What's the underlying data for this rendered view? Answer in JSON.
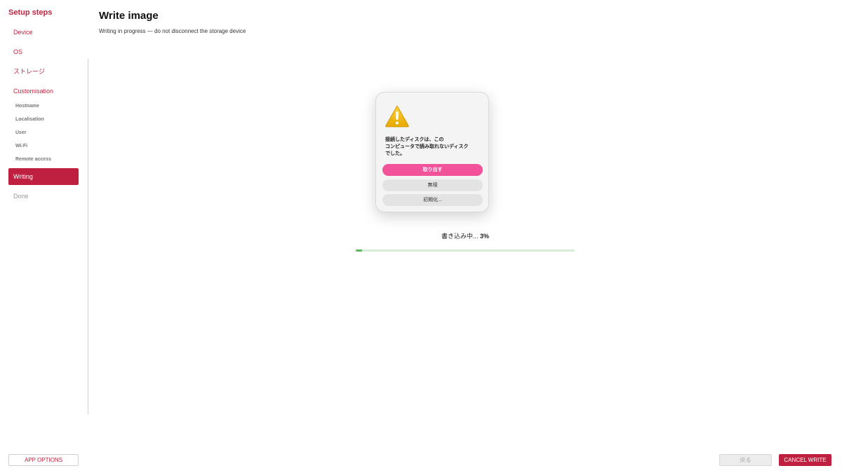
{
  "sidebar": {
    "title": "Setup steps",
    "items": [
      {
        "label": "Device"
      },
      {
        "label": "OS"
      },
      {
        "label": "ストレージ"
      },
      {
        "label": "Customisation"
      }
    ],
    "sub_items": [
      {
        "label": "Hostname"
      },
      {
        "label": "Localisation"
      },
      {
        "label": "User"
      },
      {
        "label": "Wi-Fi"
      },
      {
        "label": "Remote access"
      }
    ],
    "active": {
      "label": "Writing"
    },
    "done": {
      "label": "Done"
    }
  },
  "header": {
    "title": "Write image",
    "subtitle": "Writing in progress — do not disconnect the storage device"
  },
  "dialog": {
    "icon": "warning-icon",
    "message": "接続したディスクは、この\nコンピュータで読み取れないディスク\nでした。",
    "buttons": {
      "eject": "取り出す",
      "ignore": "無視",
      "initialize": "初期化..."
    }
  },
  "progress": {
    "label": "書き込み中...",
    "percent_text": "3%",
    "value": 3
  },
  "footer": {
    "app_options": "APP OPTIONS",
    "back": "戻る",
    "cancel_write": "CANCEL WRITE"
  },
  "colors": {
    "accent": "#c0203f",
    "primary_button": "#f2529a",
    "progress": "#5cb85c"
  }
}
